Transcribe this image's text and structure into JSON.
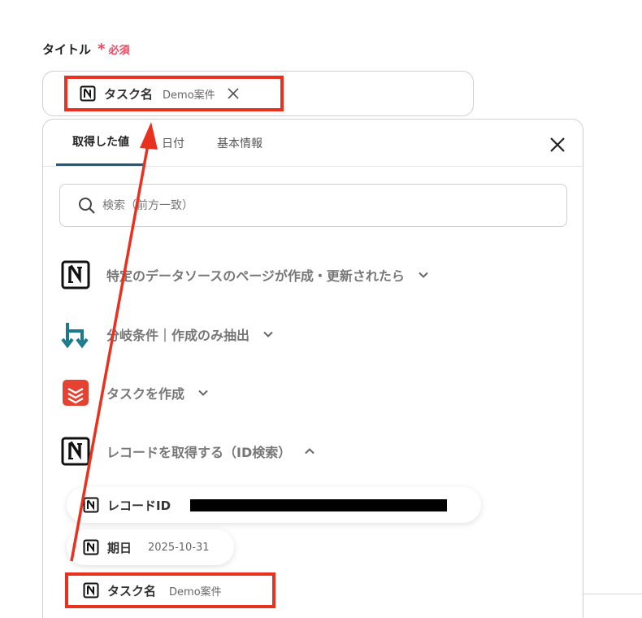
{
  "field": {
    "label": "タイトル",
    "required_mark": "*",
    "required_text": "必須",
    "chip": {
      "icon": "notion-icon",
      "label": "タスク名",
      "value": "Demo案件"
    }
  },
  "picker": {
    "tabs": [
      {
        "label": "取得した値",
        "active": true
      },
      {
        "label": "日付",
        "active": false
      },
      {
        "label": "基本情報",
        "active": false
      }
    ],
    "search": {
      "placeholder": "検索（前方一致）"
    },
    "sections": [
      {
        "icon": "notion-icon",
        "label": "特定のデータソースのページが作成・更新されたら",
        "expanded": false
      },
      {
        "icon": "branch-icon",
        "label": "分岐条件｜作成のみ抽出",
        "expanded": false
      },
      {
        "icon": "todoist-icon",
        "label": "タスクを作成",
        "expanded": false
      },
      {
        "icon": "notion-icon",
        "label": "レコードを取得する（ID検索）",
        "expanded": true
      }
    ],
    "items": [
      {
        "icon": "notion-icon",
        "label": "レコードID",
        "value": "",
        "redacted": true
      },
      {
        "icon": "notion-icon",
        "label": "期日",
        "value": "2025-10-31"
      },
      {
        "icon": "notion-icon",
        "label": "タスク名",
        "value": "Demo案件"
      }
    ]
  },
  "colors": {
    "required": "#e8485f",
    "tab_indicator": "#1b5d7a",
    "highlight": "#e8321f",
    "branch_icon": "#1b7a8c",
    "todoist": "#e44332"
  }
}
